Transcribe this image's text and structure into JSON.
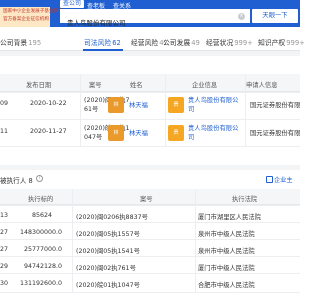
{
  "header": {
    "promo_line1": "国家中小企业发展子基金旗下",
    "promo_line2": "官方备案企业征信机构",
    "tabs": [
      {
        "label": "查公司",
        "active": true
      },
      {
        "label": "查老板",
        "active": false
      },
      {
        "label": "查关系",
        "active": false
      }
    ],
    "search_value": "贵人鸟股份有限公司",
    "search_button": "天眼一下"
  },
  "nav": {
    "tabs": [
      {
        "label": "公司背景",
        "count": "195"
      },
      {
        "label": "司法风险",
        "count": "62"
      },
      {
        "label": "经营风险",
        "count": "47"
      },
      {
        "label": "公司发展",
        "count": "49"
      },
      {
        "label": "经营状况",
        "count": "999+"
      },
      {
        "label": "知识产权",
        "count": "999+"
      }
    ]
  },
  "table1": {
    "headers": [
      "发布日期",
      "案号",
      "姓名",
      "企业信息",
      "申请人信息"
    ],
    "rows": [
      {
        "idx": "09",
        "date": "2020-10-22",
        "case_no": "(2020)闽02执7\n61号",
        "name": "林天福",
        "company": "贵人鸟股份有限公\n司",
        "applicant": "国元证券股份有限"
      },
      {
        "idx": "11",
        "date": "2020-11-27",
        "case_no": "(2020)皖01执1\n047号",
        "name": "林天福",
        "company": "贵人鸟股份有限公\n司",
        "applicant": "国元证券股份有限"
      }
    ]
  },
  "section2": {
    "title": "被执行人",
    "count": "8",
    "link": "企业主",
    "headers": [
      "执行标的",
      "案号",
      "执行法院"
    ],
    "rows": [
      {
        "idx": "13",
        "amount": "85624",
        "case_no": "(2020)闽0206执8837号",
        "court": "厦门市湖里区人民法院"
      },
      {
        "idx": "27",
        "amount": "148300000.0",
        "case_no": "(2020)闽05执1557号",
        "court": "泉州市中级人民法院"
      },
      {
        "idx": "27",
        "amount": "25777000.0",
        "case_no": "(2020)闽05执1541号",
        "court": "泉州市中级人民法院"
      },
      {
        "idx": "29",
        "amount": "94742128.0",
        "case_no": "(2020)闽02执761号",
        "court": "厦门市中级人民法院"
      },
      {
        "idx": "30",
        "amount": "131192600.0",
        "case_no": "(2020)皖01执1047号",
        "court": "合肥市中级人民法院"
      }
    ]
  }
}
